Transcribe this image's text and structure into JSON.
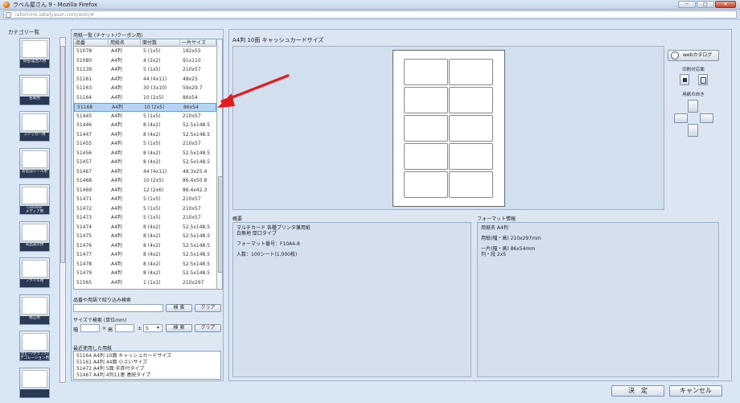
{
  "window": {
    "title": "ラベル屋さん 9 - Mozilla Firefox",
    "url": "labelnine.labelyasan.com/web/#",
    "controls": [
      "─",
      "□",
      "✕"
    ]
  },
  "sidebar": {
    "title": "カテゴリ一覧",
    "items": [
      {
        "label": "宛名/差出人用"
      },
      {
        "label": "名刺用"
      },
      {
        "label": "ステッカー用"
      },
      {
        "label": "お名前シール用"
      },
      {
        "label": "CD/DVD/\nメディア用"
      },
      {
        "label": "商品表示用"
      },
      {
        "label": "ファイル用"
      },
      {
        "label": "修正用"
      },
      {
        "label": "ホビー/クラフト/\nデコレーション用"
      },
      {
        "label": ""
      }
    ]
  },
  "paper_list": {
    "title": "用紙一覧 (チケット/クーポン用)",
    "columns": [
      "品番",
      "用紙名",
      "面付数",
      "一片サイズ"
    ],
    "rows": [
      [
        "51078",
        "A4判",
        "5 (1x5)",
        "182x55"
      ],
      [
        "51080",
        "A4判",
        "4 (2x2)",
        "91x110"
      ],
      [
        "51139",
        "A4判",
        "5 (1x5)",
        "210x57"
      ],
      [
        "51161",
        "A4判",
        "44 (4x11)",
        "48x25"
      ],
      [
        "51163",
        "A4判",
        "30 (3x10)",
        "59x29.7"
      ],
      [
        "51164",
        "A4判",
        "10 (2x5)",
        "86x54"
      ],
      [
        "51168",
        "A4判",
        "10 (2x5)",
        "86x54"
      ],
      [
        "51445",
        "A4判",
        "5 (1x5)",
        "210x57"
      ],
      [
        "51446",
        "A4判",
        "8 (4x2)",
        "52.5x148.5"
      ],
      [
        "51447",
        "A4判",
        "8 (4x2)",
        "52.5x148.5"
      ],
      [
        "51455",
        "A4判",
        "5 (1x5)",
        "210x57"
      ],
      [
        "51456",
        "A4判",
        "8 (4x2)",
        "52.5x148.5"
      ],
      [
        "51457",
        "A4判",
        "8 (4x2)",
        "52.5x148.5"
      ],
      [
        "51467",
        "A4判",
        "44 (4x11)",
        "48.3x25.4"
      ],
      [
        "51468",
        "A4判",
        "10 (2x5)",
        "86.4x50.8"
      ],
      [
        "51469",
        "A4判",
        "12 (2x6)",
        "86.4x42.3"
      ],
      [
        "51471",
        "A4判",
        "5 (1x5)",
        "210x57"
      ],
      [
        "51472",
        "A4判",
        "5 (1x5)",
        "210x57"
      ],
      [
        "51473",
        "A4判",
        "5 (1x5)",
        "210x57"
      ],
      [
        "51474",
        "A4判",
        "8 (4x2)",
        "52.5x148.5"
      ],
      [
        "51475",
        "A4判",
        "8 (4x2)",
        "52.5x148.5"
      ],
      [
        "51476",
        "A4判",
        "8 (4x2)",
        "52.5x148.5"
      ],
      [
        "51477",
        "A4判",
        "8 (4x2)",
        "52.5x148.5"
      ],
      [
        "51478",
        "A4判",
        "8 (4x2)",
        "52.5x148.5"
      ],
      [
        "51479",
        "A4判",
        "8 (4x2)",
        "52.5x148.5"
      ],
      [
        "51565",
        "A4判",
        "1 (1x1)",
        "210x297"
      ]
    ],
    "selected_row": 6
  },
  "search": {
    "keyword_label": "品番や用語で絞り込み検索",
    "keyword_value": "",
    "search_label": "検 索",
    "clear_label": "クリア",
    "size_label": "サイズで検索 (単位mm)",
    "width_label": "幅",
    "times_label": "×",
    "height_label": "高",
    "pm_label": "±",
    "tolerance": "5",
    "dropdown_arrow": "▾"
  },
  "recent": {
    "title": "最近使用した用紙",
    "items": [
      "51164 A4判 10面 キャッシュカードサイズ",
      "51161 A4判 44面 小さいサイズ",
      "51472 A4判 5面 半券付タイプ",
      "51467 A4判 4列11連 連続タイプ"
    ]
  },
  "preview": {
    "title": "A4判 10面 キャッシュカードサイズ",
    "webcatalog_label": "webカタログ",
    "print_label": "印刷対応面",
    "orientation_label": "用紙の向き"
  },
  "summary": {
    "title": "概要",
    "lines": [
      "マルチカード 各種プリンタ兼用紙",
      "白無地 厚口タイプ",
      "",
      "フォーマット番号：F10A4-8",
      "",
      "入数：100シート(1,000枚)"
    ]
  },
  "format": {
    "title": "フォーマット情報",
    "lines": [
      "用紙名 A4判",
      "",
      "用紙(幅・高) 210x297mm",
      "",
      "一片(幅・高) 86x54mm",
      "列・段 2x5"
    ]
  },
  "footer": {
    "ok_label": "決　定",
    "cancel_label": "キャンセル"
  },
  "colors": {
    "selection": "#b9d4f2",
    "arrow": "#e8191c",
    "sidebar_label_bg": "#2a3a55"
  }
}
